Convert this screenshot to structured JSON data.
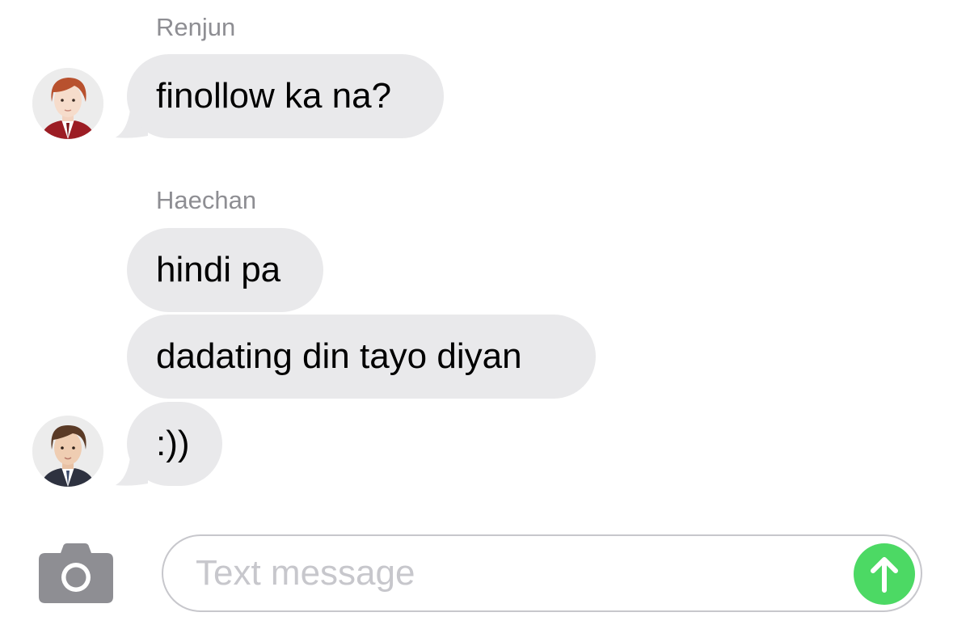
{
  "conversation": {
    "groups": [
      {
        "sender": "Renjun",
        "messages": [
          "finollow ka na?"
        ]
      },
      {
        "sender": "Haechan",
        "messages": [
          "hindi pa",
          "dadating din tayo diyan",
          ":))"
        ]
      }
    ]
  },
  "composer": {
    "placeholder": "Text message",
    "camera_icon": "camera-icon",
    "send_icon": "arrow-up-icon",
    "send_color": "#4cd964"
  },
  "colors": {
    "bubble_incoming": "#e9e9eb",
    "sender_name": "#8e8e93",
    "placeholder": "#c7c7cc"
  }
}
